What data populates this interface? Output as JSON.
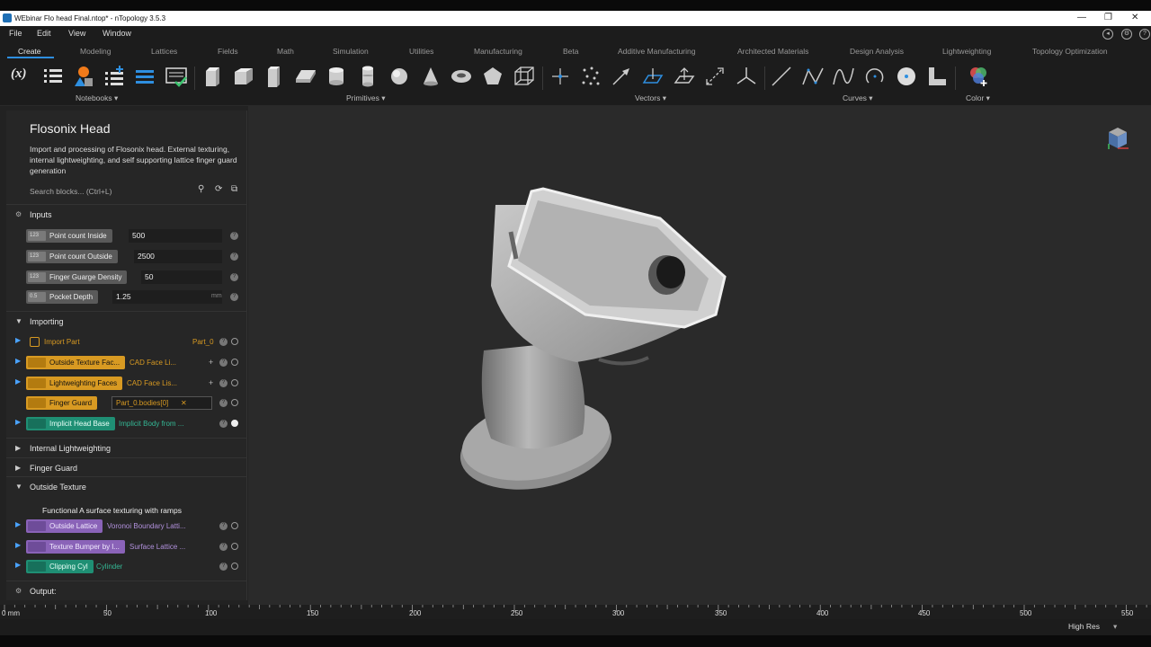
{
  "window": {
    "title": "WEbinar Flo head Final.ntop* - nTopology 3.5.3",
    "controls": [
      "—",
      "❐",
      "✕"
    ]
  },
  "menu": [
    "File",
    "Edit",
    "View",
    "Window"
  ],
  "tabs": [
    "Create",
    "Modeling",
    "Lattices",
    "Fields",
    "Math",
    "Simulation",
    "Utilities",
    "Manufacturing",
    "Beta",
    "Additive Manufacturing",
    "Architected Materials",
    "Design Analysis",
    "Lightweighting",
    "Topology Optimization"
  ],
  "toolbar": {
    "groups": [
      "Notebooks",
      "Primitives",
      "Vectors",
      "Curves",
      "Color"
    ],
    "variable_icon": "(x)"
  },
  "panel": {
    "title": "Flosonix Head",
    "description": "Import and processing of Flosonix head. External texturing, internal lightweighting, and self supporting lattice finger guard generation",
    "search_placeholder": "Search blocks... (Ctrl+L)",
    "inputs_label": "Inputs",
    "inputs": [
      {
        "type": "123",
        "name": "Point count Inside",
        "value": "500",
        "unit": ""
      },
      {
        "type": "123",
        "name": "Point count Outside",
        "value": "2500",
        "unit": ""
      },
      {
        "type": "123",
        "name": "Finger Guarge Density",
        "value": "50",
        "unit": ""
      },
      {
        "type": "0.5",
        "name": "Pocket Depth",
        "value": "1.25",
        "unit": "mm"
      }
    ],
    "importing_label": "Importing",
    "importing": {
      "import_part": {
        "name": "Import Part",
        "arg": "Part_0"
      },
      "outside_texture_faces": {
        "name": "Outside Texture Fac...",
        "arg": "CAD Face Li..."
      },
      "lightweighting_faces": {
        "name": "Lightweighting Faces",
        "arg": "CAD Face Lis..."
      },
      "finger_guard": {
        "name": "Finger Guard",
        "arg": "Part_0.bodies[0]",
        "clear": "✕"
      },
      "implicit_head_base": {
        "name": "Implicit Head Base",
        "arg": "Implicit Body from ..."
      }
    },
    "internal_lightweighting_label": "Internal Lightweighting",
    "finger_guard_label": "Finger Guard",
    "outside_texture_label": "Outside Texture",
    "outside_texture_comment": "Functional A surface texturing with ramps",
    "outside_texture": {
      "outside_lattice": {
        "name": "Outside Lattice",
        "arg": "Voronoi Boundary Latti..."
      },
      "texture_bumper": {
        "name": "Texture Bumper by l...",
        "arg": "Surface Lattice ..."
      },
      "clipping_cyl": {
        "name": "Clipping Cyl",
        "arg": "Cylinder"
      }
    },
    "output_label": "Output:"
  },
  "ruler": {
    "labels": [
      "0 mm",
      "50",
      "100",
      "150",
      "200",
      "250",
      "300",
      "350",
      "400",
      "450",
      "500",
      "550"
    ]
  },
  "status": {
    "resolution": "High Res"
  },
  "colors": {
    "accent": "#2e8fe0",
    "orange": "#d89a22",
    "green": "#1f8f74",
    "purple": "#8a63b8"
  }
}
